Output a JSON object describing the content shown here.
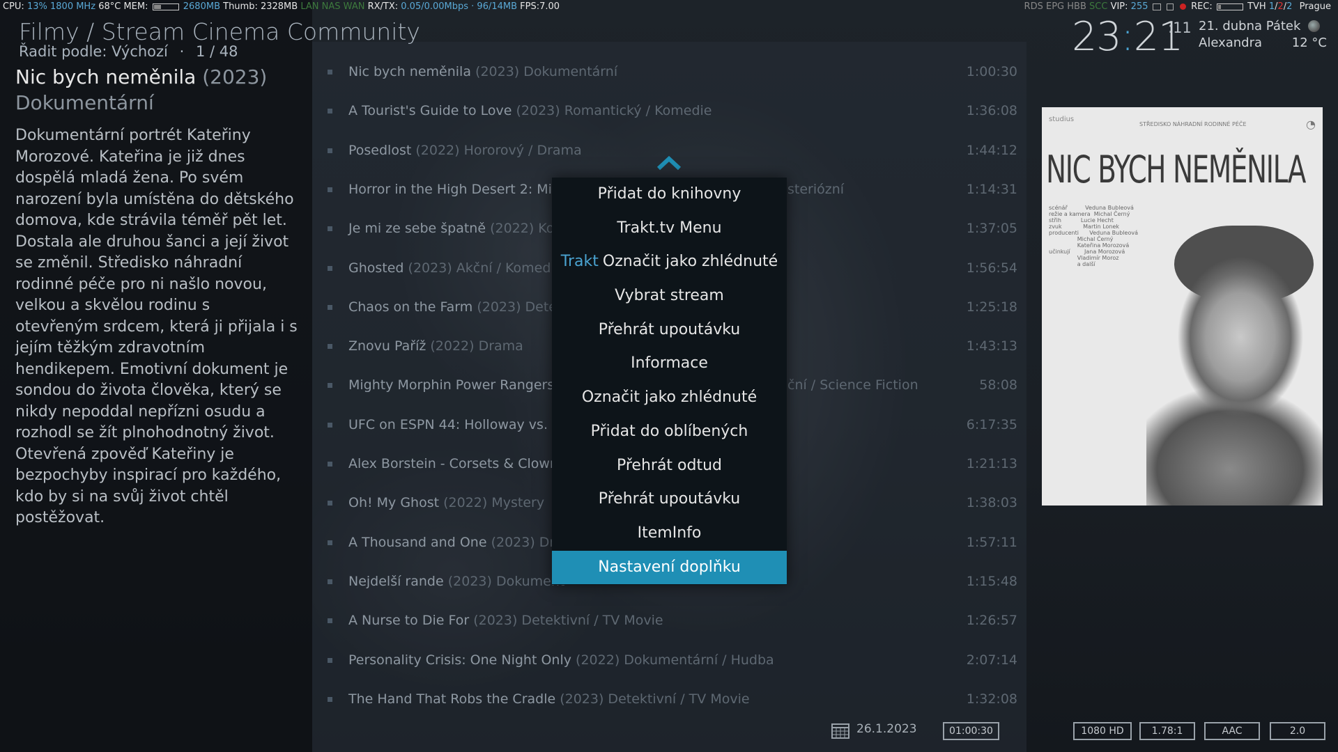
{
  "statusbar": {
    "cpu_label": "CPU:",
    "cpu_value": "13%",
    "cpu_freq": "1800 MHz",
    "cpu_temp": "68°C",
    "mem_label": "MEM:",
    "mem_value": "2680MB",
    "thumb": "Thumb: 2328MB",
    "lan": "LAN",
    "nas": "NAS",
    "wan": "WAN",
    "rxtx_label": "RX/TX:",
    "rxtx_value": "0.05/0.00Mbps · 96/14MB",
    "fps": "FPS:7.00",
    "rds": "RDS",
    "epg": "EPG",
    "hbb": "HBB",
    "scc": "SCC",
    "vip_label": "VIP:",
    "vip_value": "255",
    "rec_label": "REC:",
    "tvh_label": "TVH",
    "tvh_a": "1",
    "tvh_b": "2",
    "tvh_c": "2",
    "location": "Prague"
  },
  "header": {
    "path": "Filmy / Stream Cinema Community",
    "sort_label": "Řadit podle: Výchozí",
    "sort_sep": "·",
    "position": "1 / 48"
  },
  "selected": {
    "name": "Nic bych neměnila",
    "year": "(2023)",
    "genre": "Dokumentární",
    "plot": "Dokumentární portrét Kateřiny Morozové. Kateřina je již dnes dospělá mladá žena. Po svém narození byla umístěna do dětského domova, kde strávila téměř pět let. Dostala ale druhou šanci a její život se změnil. Středisko náhradní rodinné péče pro ni našlo novou, velkou a skvělou rodinu s otevřeným srdcem, která ji přijala i s jejím těžkým zdravotním hendikepem. Emotivní dokument je sondou do života člověka, který se nikdy nepoddal nepřízni osudu a rozhodl se žít plnohodnotný život. Otevřená zpověď Kateřiny je bezpochyby inspirací pro každého, kdo by si na svůj život chtěl postěžovat."
  },
  "clock": {
    "hours": "23",
    "colon": ":",
    "minutes": "21",
    "seconds": ":11",
    "date": "21. dubna Pátek",
    "name": "Alexandra",
    "temp": "12 °C"
  },
  "list": [
    {
      "title": "Nic bych neměnila",
      "meta": "(2023) Dokumentární",
      "duration": "1:00:30"
    },
    {
      "title": "A Tourist's Guide to Love",
      "meta": "(2023) Romantický / Komedie",
      "duration": "1:36:08"
    },
    {
      "title": "Posedlost",
      "meta": "(2022) Hororový / Drama",
      "duration": "1:44:12"
    },
    {
      "title": "Horror in the High Desert 2: Min",
      "meta": "",
      "tail": "steriózní",
      "duration": "1:14:31"
    },
    {
      "title": "Je mi ze sebe špatně",
      "meta": "(2022) Kom",
      "duration": "1:37:05"
    },
    {
      "title": "Ghosted",
      "meta": "(2023) Akční / Komedie",
      "duration": "1:56:54"
    },
    {
      "title": "Chaos on the Farm",
      "meta": "(2023) Detek",
      "duration": "1:25:18"
    },
    {
      "title": "Znovu Paříž",
      "meta": "(2022) Drama",
      "duration": "1:43:13"
    },
    {
      "title": "Mighty Morphin Power Rangers",
      "meta": "",
      "tail": "ční / Science Fiction",
      "duration": "58:08"
    },
    {
      "title": "UFC on ESPN 44: Holloway vs. Al",
      "meta": "",
      "duration": "6:17:35"
    },
    {
      "title": "Alex Borstein - Corsets & Clown",
      "meta": "",
      "duration": "1:21:13"
    },
    {
      "title": "Oh! My Ghost",
      "meta": "(2022) Mystery",
      "duration": "1:38:03"
    },
    {
      "title": "A Thousand and One",
      "meta": "(2023) Dra",
      "duration": "1:57:11"
    },
    {
      "title": "Nejdelší rande",
      "meta": "(2023) Dokument",
      "duration": "1:15:48"
    },
    {
      "title": "A Nurse to Die For",
      "meta": "(2023) Detektivní / TV Movie",
      "duration": "1:26:57"
    },
    {
      "title": "Personality Crisis: One Night Only",
      "meta": "(2022) Dokumentární / Hudba",
      "duration": "2:07:14"
    },
    {
      "title": "The Hand That Robs the Cradle",
      "meta": "(2023) Detektivní / TV Movie",
      "duration": "1:32:08"
    }
  ],
  "context_menu": {
    "items": [
      {
        "label": "Přidat do knihovny"
      },
      {
        "label": "Trakt.tv Menu"
      },
      {
        "prefix": "Trakt",
        "label": "Označit jako zhlédnuté"
      },
      {
        "label": "Vybrat stream"
      },
      {
        "label": "Přehrát upoutávku"
      },
      {
        "label": "Informace"
      },
      {
        "label": "Označit jako zhlédnuté"
      },
      {
        "label": "Přidat do oblíbených"
      },
      {
        "label": "Přehrát odtud"
      },
      {
        "label": "Přehrát upoutávku"
      },
      {
        "label": "ItemInfo"
      },
      {
        "label": "Nastavení doplňku",
        "selected": true
      }
    ]
  },
  "poster": {
    "title": "NIC BYCH NEMĚNILA",
    "logo_left": "studius",
    "logo_mid": "STŘEDISKO NÁHRADNÍ RODINNÉ PÉČE",
    "credits": "scénář          Veduna Bubleová\nrežie a kamera  Michal Černý\nstřih           Lucie Hecht\nzvuk            Martin Lonek\nproducenti      Veduna Bubleová\n                Michal Černý\n                Kateřina Morozová\nučinkují        Jana Morozová\n                Vladimír Moroz\n                a další"
  },
  "bottom": {
    "date": "26.1.2023",
    "runtime": "01:00:30",
    "resolution": "1080 HD",
    "aspect": "1.78:1",
    "audio": "AAC",
    "channels": "2.0"
  },
  "colors": {
    "accent": "#4aa3d1",
    "selected_bg": "#1f8fb5"
  }
}
